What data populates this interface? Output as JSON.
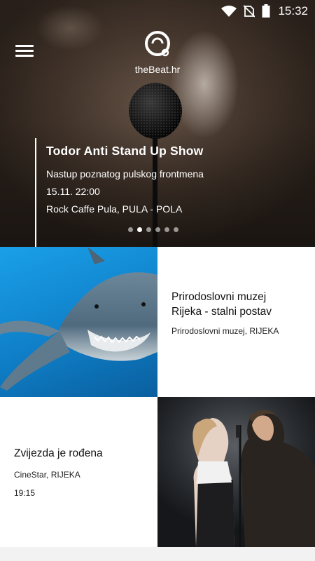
{
  "status_bar": {
    "time": "15:32",
    "icons": [
      "wifi-icon",
      "no-sim-icon",
      "battery-icon"
    ]
  },
  "app": {
    "logo_text": "theBeat.hr"
  },
  "featured": {
    "title": "Todor Anti Stand Up Show",
    "description": "Nastup poznatog pulskog frontmena",
    "datetime": "15.11. 22:00",
    "venue": "Rock Caffe Pula, PULA - POLA",
    "slides_total": 6,
    "active_slide": 2
  },
  "cards": [
    {
      "title_line1": "Prirodoslovni muzej",
      "title_line2": "Rijeka - stalni postav",
      "location": "Prirodoslovni muzej, RIJEKA",
      "image": "shark-photo"
    },
    {
      "title": "Zvijezda je rođena",
      "location": "CineStar, RIJEKA",
      "time": "19:15",
      "image": "concert-couple-photo"
    }
  ],
  "colors": {
    "hero_dark": "#2a211b",
    "shark_water": "#0f7fc8",
    "text_dark": "#111111",
    "background": "#f2f2f2"
  }
}
